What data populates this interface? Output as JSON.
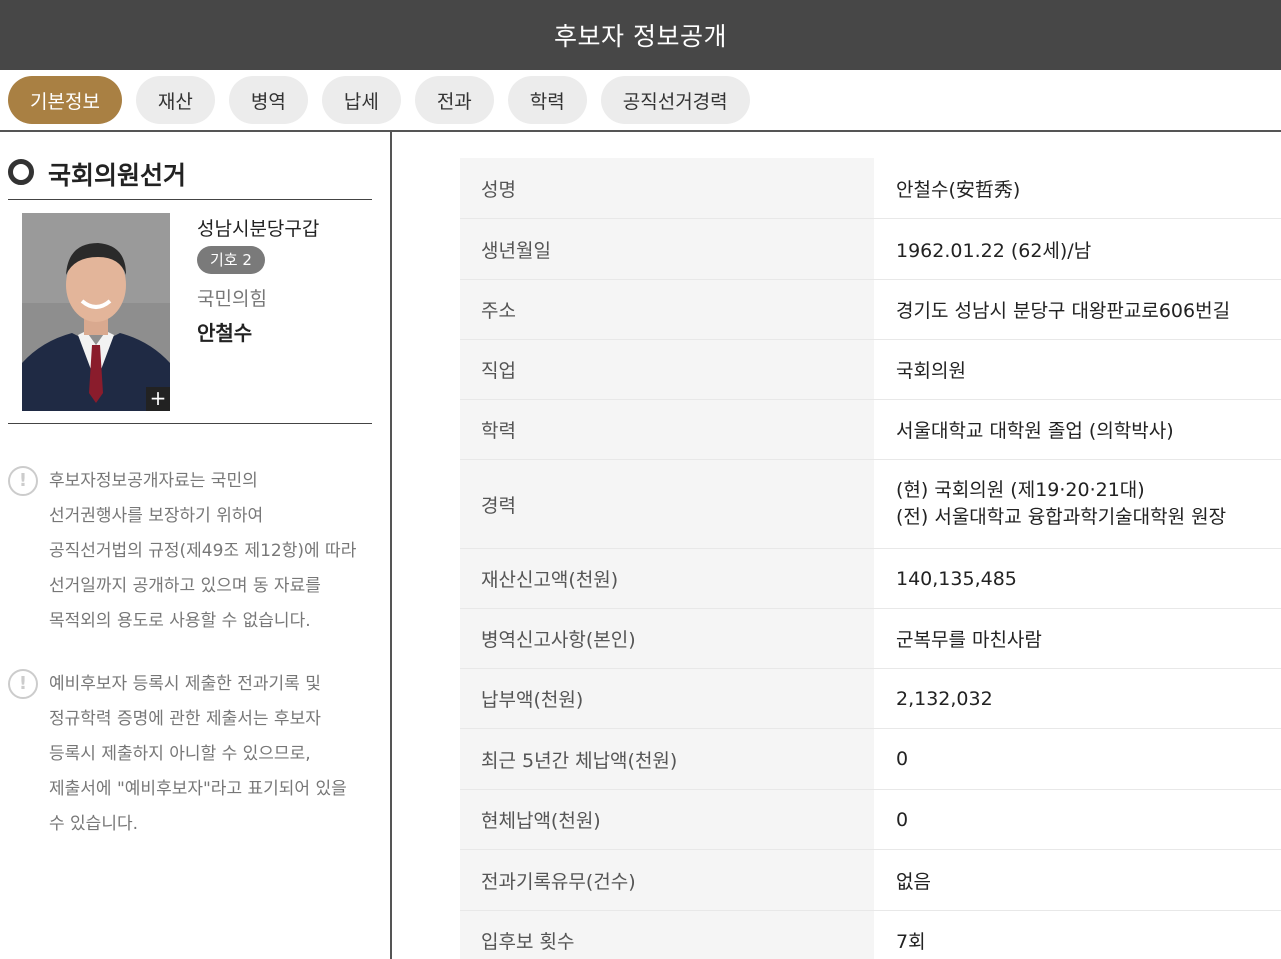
{
  "header": {
    "title": "후보자 정보공개"
  },
  "tabs": [
    {
      "label": "기본정보",
      "active": true
    },
    {
      "label": "재산",
      "active": false
    },
    {
      "label": "병역",
      "active": false
    },
    {
      "label": "납세",
      "active": false
    },
    {
      "label": "전과",
      "active": false
    },
    {
      "label": "학력",
      "active": false
    },
    {
      "label": "공직선거경력",
      "active": false
    }
  ],
  "section": {
    "title": "국회의원선거"
  },
  "candidate": {
    "district": "성남시분당구갑",
    "number_badge": "기호 2",
    "party": "국민의힘",
    "name": "안철수",
    "photo_plus": "+"
  },
  "notices": [
    {
      "icon": "exclamation-icon",
      "lines": [
        "후보자정보공개자료는 국민의",
        "선거권행사를 보장하기 위하여",
        "공직선거법의 규정(제49조 제12항)에 따라",
        "선거일까지 공개하고 있으며 동 자료를",
        "목적외의 용도로 사용할 수 없습니다."
      ]
    },
    {
      "icon": "exclamation-icon",
      "lines": [
        "예비후보자 등록시 제출한 전과기록 및",
        "정규학력 증명에 관한 제출서는 후보자",
        "등록시 제출하지 아니할 수 있으므로,",
        "제출서에 \"예비후보자\"라고 표기되어 있을",
        "수 있습니다."
      ]
    }
  ],
  "info_table": [
    {
      "label": "성명",
      "value": [
        "안철수(安哲秀)"
      ]
    },
    {
      "label": "생년월일",
      "value": [
        "1962.01.22 (62세)/남"
      ]
    },
    {
      "label": "주소",
      "value": [
        "경기도 성남시 분당구 대왕판교로606번길"
      ]
    },
    {
      "label": "직업",
      "value": [
        "국회의원"
      ]
    },
    {
      "label": "학력",
      "value": [
        "서울대학교 대학원 졸업 (의학박사)"
      ]
    },
    {
      "label": "경력",
      "value": [
        "(현) 국회의원 (제19·20·21대)",
        "(전) 서울대학교 융합과학기술대학원 원장"
      ]
    },
    {
      "label": "재산신고액(천원)",
      "value": [
        "140,135,485"
      ]
    },
    {
      "label": "병역신고사항(본인)",
      "value": [
        "군복무를 마친사람"
      ]
    },
    {
      "label": "납부액(천원)",
      "value": [
        "2,132,032"
      ]
    },
    {
      "label": "최근 5년간 체납액(천원)",
      "value": [
        "0"
      ]
    },
    {
      "label": "현체납액(천원)",
      "value": [
        "0"
      ]
    },
    {
      "label": "전과기록유무(건수)",
      "value": [
        "없음"
      ]
    },
    {
      "label": "입후보 횟수",
      "value": [
        "7회"
      ]
    }
  ]
}
